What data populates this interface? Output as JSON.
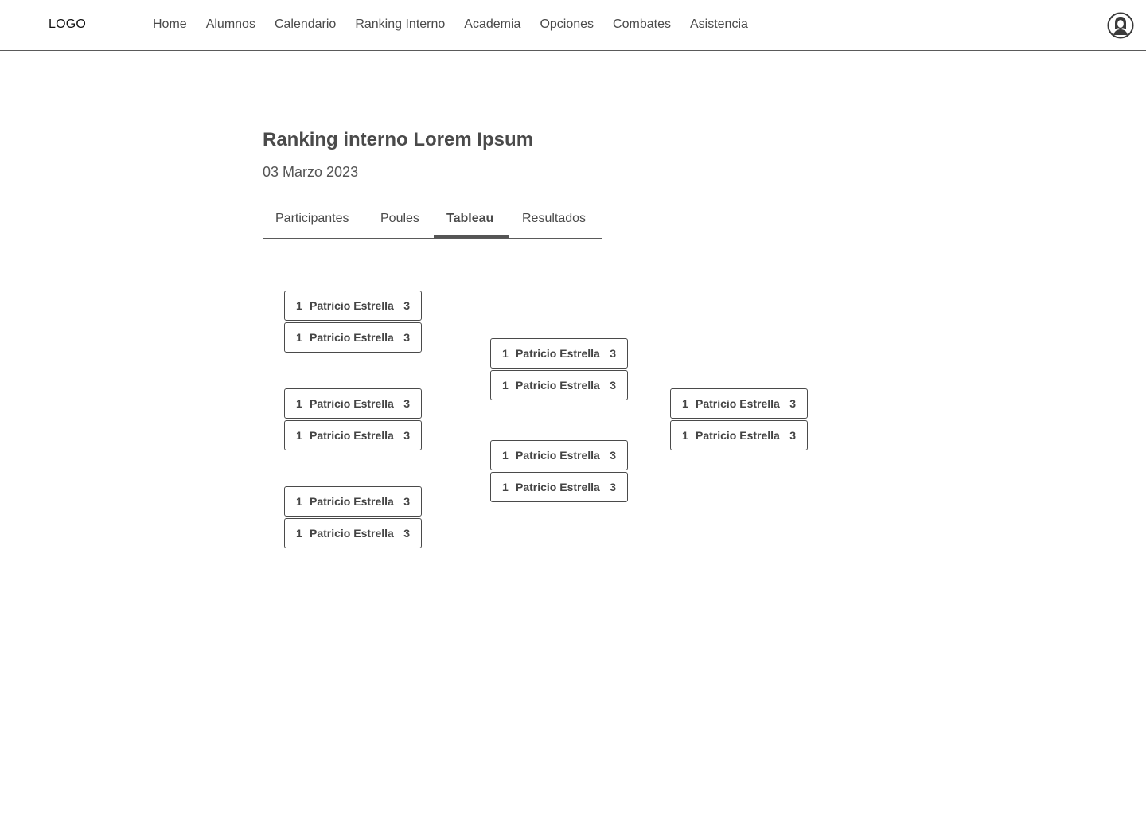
{
  "header": {
    "logo": "LOGO",
    "nav": [
      "Home",
      "Alumnos",
      "Calendario",
      "Ranking Interno",
      "Academia",
      "Opciones",
      "Combates",
      "Asistencia"
    ]
  },
  "page": {
    "title": "Ranking interno Lorem Ipsum",
    "date": "03 Marzo 2023"
  },
  "tabs": {
    "items": [
      "Participantes",
      "Poules",
      "Tableau",
      "Resultados"
    ],
    "active": "Tableau"
  },
  "bracket": {
    "rounds": [
      {
        "matches": [
          [
            {
              "seed": "1",
              "name": "Patricio Estrella",
              "score": "3"
            },
            {
              "seed": "1",
              "name": "Patricio Estrella",
              "score": "3"
            }
          ],
          [
            {
              "seed": "1",
              "name": "Patricio Estrella",
              "score": "3"
            },
            {
              "seed": "1",
              "name": "Patricio Estrella",
              "score": "3"
            }
          ],
          [
            {
              "seed": "1",
              "name": "Patricio Estrella",
              "score": "3"
            },
            {
              "seed": "1",
              "name": "Patricio Estrella",
              "score": "3"
            }
          ]
        ]
      },
      {
        "matches": [
          [
            {
              "seed": "1",
              "name": "Patricio Estrella",
              "score": "3"
            },
            {
              "seed": "1",
              "name": "Patricio Estrella",
              "score": "3"
            }
          ],
          [
            {
              "seed": "1",
              "name": "Patricio Estrella",
              "score": "3"
            },
            {
              "seed": "1",
              "name": "Patricio Estrella",
              "score": "3"
            }
          ]
        ]
      },
      {
        "matches": [
          [
            {
              "seed": "1",
              "name": "Patricio Estrella",
              "score": "3"
            },
            {
              "seed": "1",
              "name": "Patricio Estrella",
              "score": "3"
            }
          ]
        ]
      }
    ]
  }
}
